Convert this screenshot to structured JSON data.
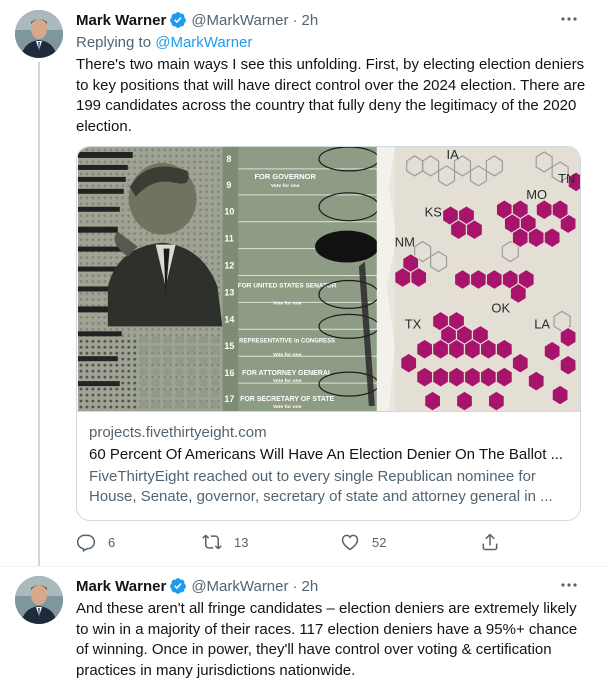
{
  "tweets": [
    {
      "author": {
        "name": "Mark Warner",
        "handle": "@MarkWarner",
        "time": "2h",
        "avatar_icon": "avatar-photo"
      },
      "replying_to": {
        "prefix": "Replying to ",
        "handle": "@MarkWarner"
      },
      "text": "There's two main ways I see this unfolding. First, by electing election deniers to key positions that will have direct control over the 2024 election. There are 199 candidates across the country that fully deny the legitimacy of the 2020 election.",
      "card": {
        "domain": "projects.fivethirtyeight.com",
        "title": "60 Percent Of Americans Will Have An Election Denier On The Ballot ...",
        "description": "FiveThirtyEight reached out to every single Republican nominee for House, Senate, governor, secretary of state and attorney general in ...",
        "image": {
          "ballot_numbers": [
            "8",
            "9",
            "10",
            "11",
            "12",
            "13",
            "14",
            "15",
            "16",
            "17"
          ],
          "ballot_offices": [
            {
              "title": "FOR GOVERNOR",
              "sub": "Vote for one"
            },
            {
              "title": "FOR UNITED STATES SENATOR",
              "sub": "Vote for one"
            },
            {
              "title": "REPRESENTATIVE in CONGRESS",
              "sub": "Vote for one"
            },
            {
              "title": "FOR ATTORNEY GENERAL",
              "sub": "Vote for one"
            },
            {
              "title": "FOR SECRETARY OF STATE",
              "sub": "Vote for one"
            }
          ],
          "state_labels": [
            "IA",
            "TN",
            "MO",
            "KS",
            "NM",
            "OK",
            "TX",
            "LA"
          ],
          "colors": {
            "magenta": "#a8136b",
            "ballot_green": "#8e9c85",
            "photo_gray": "#9aa08f"
          }
        }
      },
      "actions": {
        "replies": "6",
        "retweets": "13",
        "likes": "52"
      }
    },
    {
      "author": {
        "name": "Mark Warner",
        "handle": "@MarkWarner",
        "time": "2h",
        "avatar_icon": "avatar-photo"
      },
      "text": "And these aren't all fringe candidates – election deniers are extremely likely to win in a majority of their races. 117 election deniers have a 95%+ chance of winning. Once in power, they'll have control over voting & certification practices in many jurisdictions nationwide."
    }
  ],
  "ui": {
    "dot": "·",
    "colors": {
      "verified": "#1d9bf0",
      "link": "#1d9bf0",
      "secondary_text": "#536471"
    }
  }
}
